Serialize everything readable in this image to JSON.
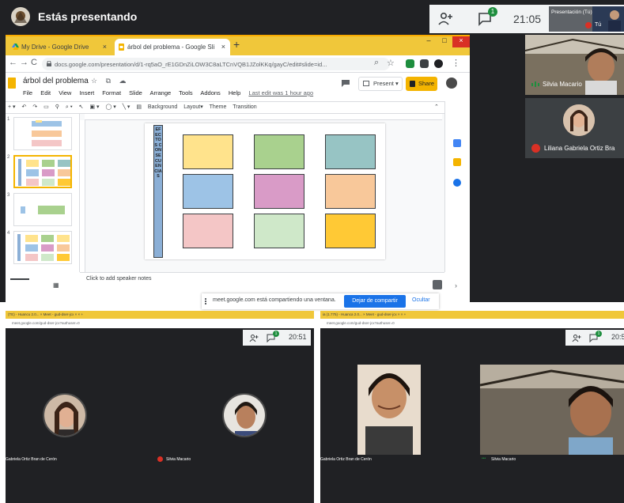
{
  "presenting": {
    "title": "Estás presentando",
    "clock": "21:05",
    "chat_badge": "1",
    "presentation_tile_label": "Presentación (Tú)",
    "you_label": "Tú"
  },
  "participants": {
    "silvia": "Silvia Macario",
    "liliana": "Liliana Gabriela Ortiz Bra"
  },
  "browser": {
    "tabs": [
      {
        "label": "My Drive - Google Drive"
      },
      {
        "label": "árbol del problema - Google Sli"
      }
    ],
    "url": "docs.google.com/presentation/d/1-rq5aO_rE1GDnZiLOW3C8aLTCnVQB1JZolKKq/gayC/edit#slide=id..."
  },
  "slides_app": {
    "doc_title": "árbol del problema",
    "menus": [
      "File",
      "Edit",
      "View",
      "Insert",
      "Format",
      "Slide",
      "Arrange",
      "Tools",
      "Addons",
      "Help"
    ],
    "last_edit": "Last edit was 1 hour ago",
    "present_label": "Present",
    "share_label": "Share",
    "toolbar_items": [
      "Background",
      "Layout▾",
      "Theme",
      "Transition"
    ],
    "notes_placeholder": "Click to add speaker notes",
    "slide_vertical_text": "EFECTOS CONSECUENCIAS",
    "boxes": [
      {
        "color": "#ffe38c"
      },
      {
        "color": "#a9d18e"
      },
      {
        "color": "#97c4c4"
      },
      {
        "color": "#9dc3e6"
      },
      {
        "color": "#d99bc7"
      },
      {
        "color": "#f8c89a"
      },
      {
        "color": "#f4c6c6"
      },
      {
        "color": "#cfe8c9"
      },
      {
        "color": "#ffc935"
      }
    ],
    "thumb_numbers": [
      "1",
      "2",
      "3",
      "4"
    ]
  },
  "share_banner": {
    "message": "meet.google.com está compartiendo una ventana.",
    "stop_label": "Dejar de compartir",
    "hide_label": "Ocultar"
  },
  "shot_left": {
    "tabs_text": "(TE) - Huancu 2.0...  ×   Meet - gud-dser-jcx   ×   ×   +",
    "url": "meet.google.com/gud-dser-jcx?authuser=0",
    "clock": "20:51",
    "chat_badge": "1",
    "name_left": "Gabriela Ortiz Bran de Cerón",
    "name_right": "Silvia Macario"
  },
  "shot_right": {
    "tabs_text": "ia (1.775) - Huanca 2.0...  ×   Meet - gud-dser-jcx   ×   ×   +",
    "url": "meet.google.com/gud-dser-jcx?authuser=0",
    "clock": "20:5",
    "chat_badge": "1",
    "name_left": "Gabriela Ortiz Bran de Cerón",
    "name_right": "Silvia Macario"
  },
  "colors": {
    "meet_dark": "#202124",
    "accent_blue": "#1a73e8",
    "mic_off_red": "#d93025",
    "chrome_yellow": "#f0c73a",
    "share_yellow": "#f4b400"
  }
}
